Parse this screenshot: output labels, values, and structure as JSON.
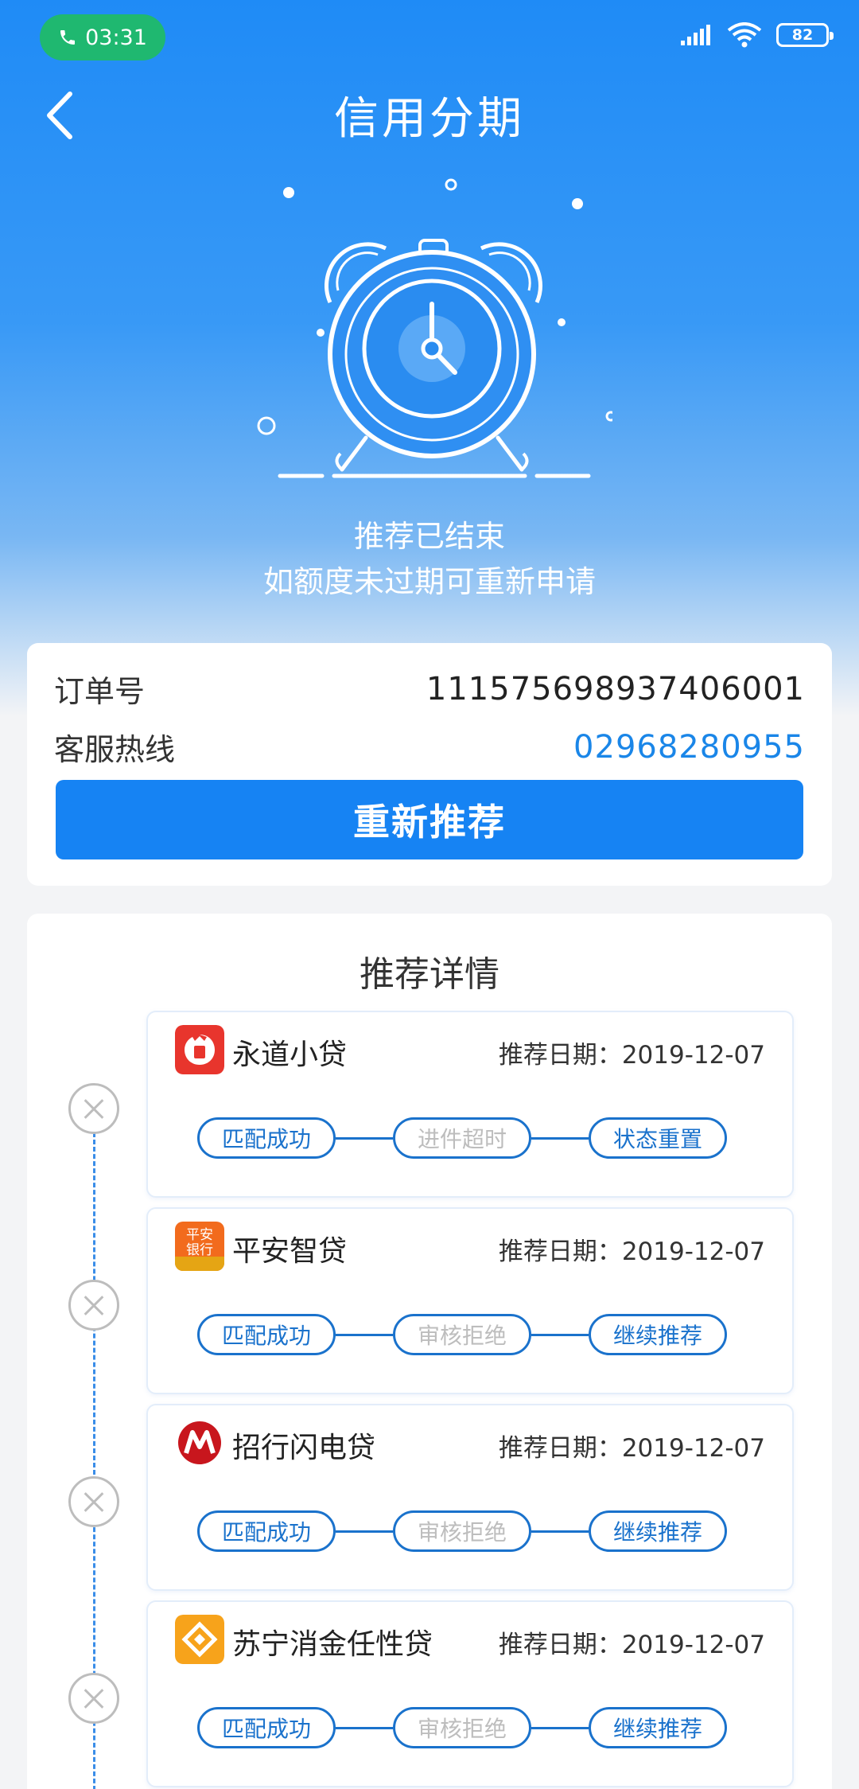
{
  "status_bar": {
    "time": "03:31",
    "battery": "82"
  },
  "header": {
    "title": "信用分期"
  },
  "result": {
    "line1": "推荐已结束",
    "line2": "如额度未过期可重新申请"
  },
  "order": {
    "order_label": "订单号",
    "order_no": "111575698937406001",
    "hotline_label": "客服热线",
    "hotline": "02968280955",
    "button": "重新推荐"
  },
  "details": {
    "title": "推荐详情",
    "items": [
      {
        "name": "永道小贷",
        "date": "推荐日期：2019-12-07",
        "logo": "yongdao-logo",
        "steps": [
          "匹配成功",
          "进件超时",
          "状态重置"
        ]
      },
      {
        "name": "平安智贷",
        "date": "推荐日期：2019-12-07",
        "logo": "pingan-bank-logo",
        "steps": [
          "匹配成功",
          "审核拒绝",
          "继续推荐"
        ]
      },
      {
        "name": "招行闪电贷",
        "date": "推荐日期：2019-12-07",
        "logo": "cmb-logo",
        "steps": [
          "匹配成功",
          "审核拒绝",
          "继续推荐"
        ]
      },
      {
        "name": "苏宁消金任性贷",
        "date": "推荐日期：2019-12-07",
        "logo": "suning-logo",
        "steps": [
          "匹配成功",
          "审核拒绝",
          "继续推荐"
        ]
      }
    ]
  },
  "colors": {
    "primary": "#1683f3",
    "accent_text": "#1a86e8",
    "step_border": "#1a72cc",
    "call_pill": "#1fb870"
  },
  "logo_text": {
    "pingan": "平安银行"
  }
}
